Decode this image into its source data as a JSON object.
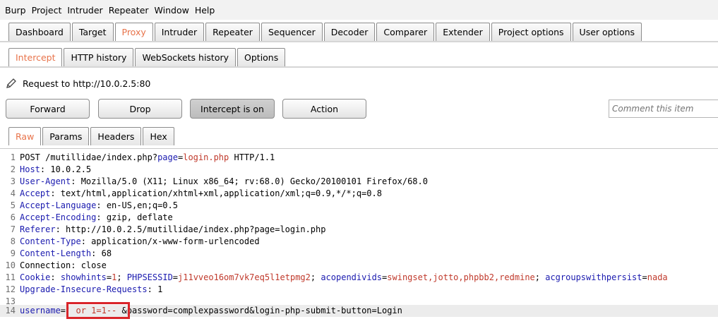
{
  "menu": [
    "Burp",
    "Project",
    "Intruder",
    "Repeater",
    "Window",
    "Help"
  ],
  "main_tabs": [
    "Dashboard",
    "Target",
    "Proxy",
    "Intruder",
    "Repeater",
    "Sequencer",
    "Decoder",
    "Comparer",
    "Extender",
    "Project options",
    "User options"
  ],
  "main_tab_selected": "Proxy",
  "sub_tabs": [
    "Intercept",
    "HTTP history",
    "WebSockets history",
    "Options"
  ],
  "sub_tab_selected": "Intercept",
  "request_label": "Request to http://10.0.2.5:80",
  "buttons": {
    "forward": "Forward",
    "drop": "Drop",
    "intercept": "Intercept is on",
    "action": "Action"
  },
  "comment_placeholder": "Comment this item",
  "editor_tabs": [
    "Raw",
    "Params",
    "Headers",
    "Hex"
  ],
  "editor_tab_selected": "Raw",
  "request_lines": [
    {
      "n": "1",
      "parts": [
        [
          "t",
          "POST /mutillidae/index.php?"
        ],
        [
          "h",
          "page"
        ],
        [
          "t",
          "="
        ],
        [
          "r",
          "login.php"
        ],
        [
          "t",
          " HTTP/1.1"
        ]
      ]
    },
    {
      "n": "2",
      "parts": [
        [
          "h",
          "Host"
        ],
        [
          "t",
          ": 10.0.2.5"
        ]
      ]
    },
    {
      "n": "3",
      "parts": [
        [
          "h",
          "User-Agent"
        ],
        [
          "t",
          ": Mozilla/5.0 (X11; Linux x86_64; rv:68.0) Gecko/20100101 Firefox/68.0"
        ]
      ]
    },
    {
      "n": "4",
      "parts": [
        [
          "h",
          "Accept"
        ],
        [
          "t",
          ": text/html,application/xhtml+xml,application/xml;q=0.9,*/*;q=0.8"
        ]
      ]
    },
    {
      "n": "5",
      "parts": [
        [
          "h",
          "Accept-Language"
        ],
        [
          "t",
          ": en-US,en;q=0.5"
        ]
      ]
    },
    {
      "n": "6",
      "parts": [
        [
          "h",
          "Accept-Encoding"
        ],
        [
          "t",
          ": gzip, deflate"
        ]
      ]
    },
    {
      "n": "7",
      "parts": [
        [
          "h",
          "Referer"
        ],
        [
          "t",
          ": http://10.0.2.5/mutillidae/index.php?page=login.php"
        ]
      ]
    },
    {
      "n": "8",
      "parts": [
        [
          "h",
          "Content-Type"
        ],
        [
          "t",
          ": application/x-www-form-urlencoded"
        ]
      ]
    },
    {
      "n": "9",
      "parts": [
        [
          "h",
          "Content-Length"
        ],
        [
          "t",
          ": 68"
        ]
      ]
    },
    {
      "n": "10",
      "parts": [
        [
          "t",
          "Connection: close"
        ]
      ]
    },
    {
      "n": "11",
      "parts": [
        [
          "h",
          "Cookie"
        ],
        [
          "t",
          ": "
        ],
        [
          "h",
          "showhints"
        ],
        [
          "t",
          "="
        ],
        [
          "r",
          "1"
        ],
        [
          "t",
          "; "
        ],
        [
          "h",
          "PHPSESSID"
        ],
        [
          "t",
          "="
        ],
        [
          "r",
          "j11vveo16om7vk7eq5l1etpmg2"
        ],
        [
          "t",
          "; "
        ],
        [
          "h",
          "acopendivids"
        ],
        [
          "t",
          "="
        ],
        [
          "r",
          "swingset,jotto,phpbb2,redmine"
        ],
        [
          "t",
          "; "
        ],
        [
          "h",
          "acgroupswithpersist"
        ],
        [
          "t",
          "="
        ],
        [
          "r",
          "nada"
        ]
      ]
    },
    {
      "n": "12",
      "parts": [
        [
          "h",
          "Upgrade-Insecure-Requests"
        ],
        [
          "t",
          ": 1"
        ]
      ]
    },
    {
      "n": "13",
      "parts": []
    },
    {
      "n": "14",
      "parts": [
        [
          "h",
          "username"
        ],
        [
          "t",
          "="
        ],
        [
          "r",
          "' or 1=1-- "
        ],
        [
          "t",
          "&password=complexpassword&login-php-submit-button=Login"
        ]
      ]
    }
  ],
  "colors": {
    "accent": "#e8734a",
    "header_name": "#1a1aaf",
    "value": "#c0392b",
    "annotation_box": "#d9252a"
  }
}
